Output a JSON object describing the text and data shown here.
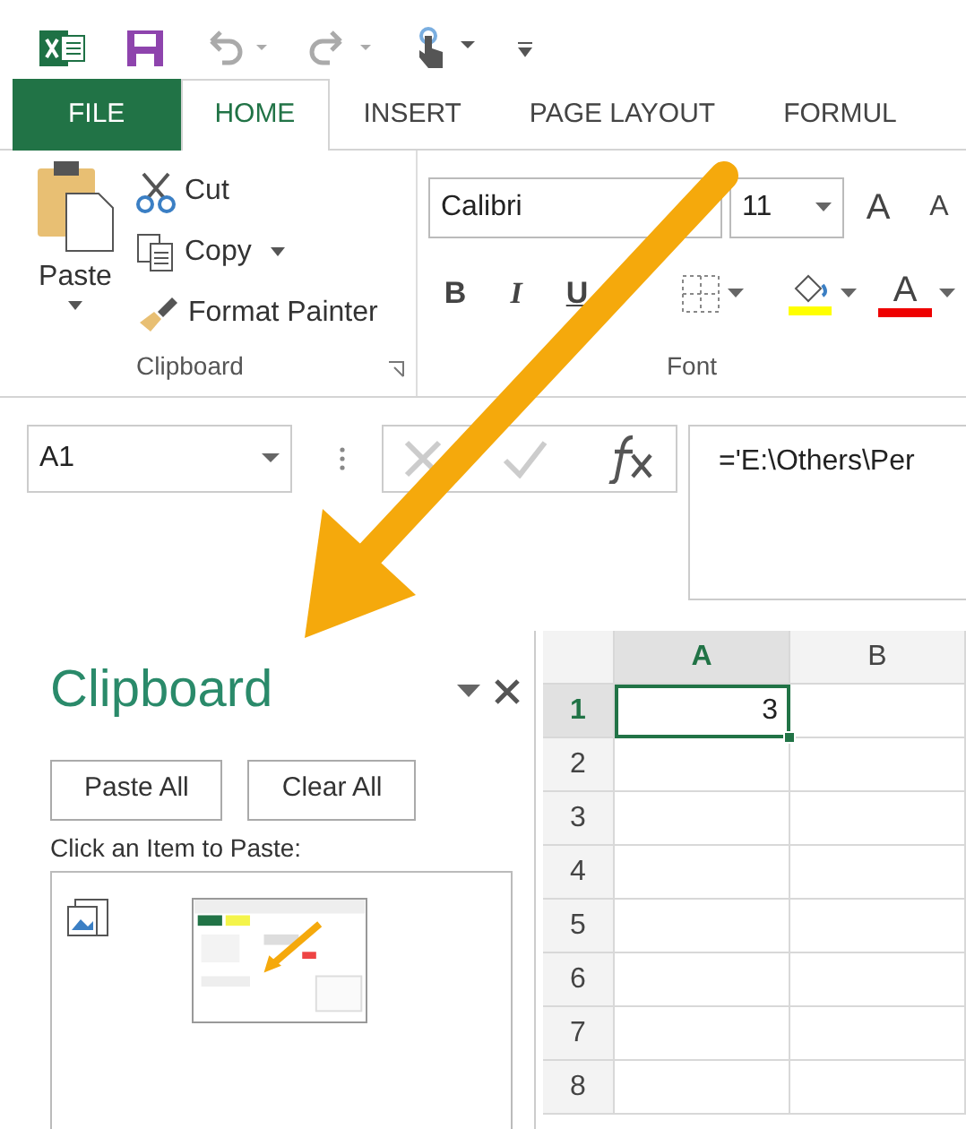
{
  "tabs": [
    {
      "label": "FILE",
      "kind": "file",
      "selected": false
    },
    {
      "label": "HOME",
      "kind": "tab",
      "selected": true
    },
    {
      "label": "INSERT",
      "kind": "tab",
      "selected": false
    },
    {
      "label": "PAGE LAYOUT",
      "kind": "tab",
      "selected": false
    },
    {
      "label": "FORMUL",
      "kind": "tab",
      "selected": false
    }
  ],
  "clipboard_group": {
    "paste": "Paste",
    "cut": "Cut",
    "copy": "Copy",
    "format_painter": "Format Painter",
    "label": "Clipboard"
  },
  "font_group": {
    "font_name": "Calibri",
    "font_size": "11",
    "grow_font": "A",
    "shrink_font": "A",
    "bold": "B",
    "italic": "I",
    "underline": "U",
    "font_color": "A",
    "label": "Font"
  },
  "name_box": "A1",
  "formula": "='E:\\Others\\Per",
  "clipboard_pane": {
    "title": "Clipboard",
    "buttons": [
      "Paste All",
      "Clear All"
    ],
    "instruction": "Click an Item to Paste:"
  },
  "sheet": {
    "columns": [
      {
        "label": "A",
        "selected": true
      },
      {
        "label": "B",
        "selected": false
      }
    ],
    "rows": [
      {
        "label": "1",
        "selected": true,
        "cells": [
          "3"
        ]
      },
      {
        "label": "2",
        "selected": false
      },
      {
        "label": "3",
        "selected": false
      },
      {
        "label": "4",
        "selected": false
      },
      {
        "label": "5",
        "selected": false
      },
      {
        "label": "6",
        "selected": false
      },
      {
        "label": "7",
        "selected": false
      },
      {
        "label": "8",
        "selected": false
      }
    ]
  }
}
